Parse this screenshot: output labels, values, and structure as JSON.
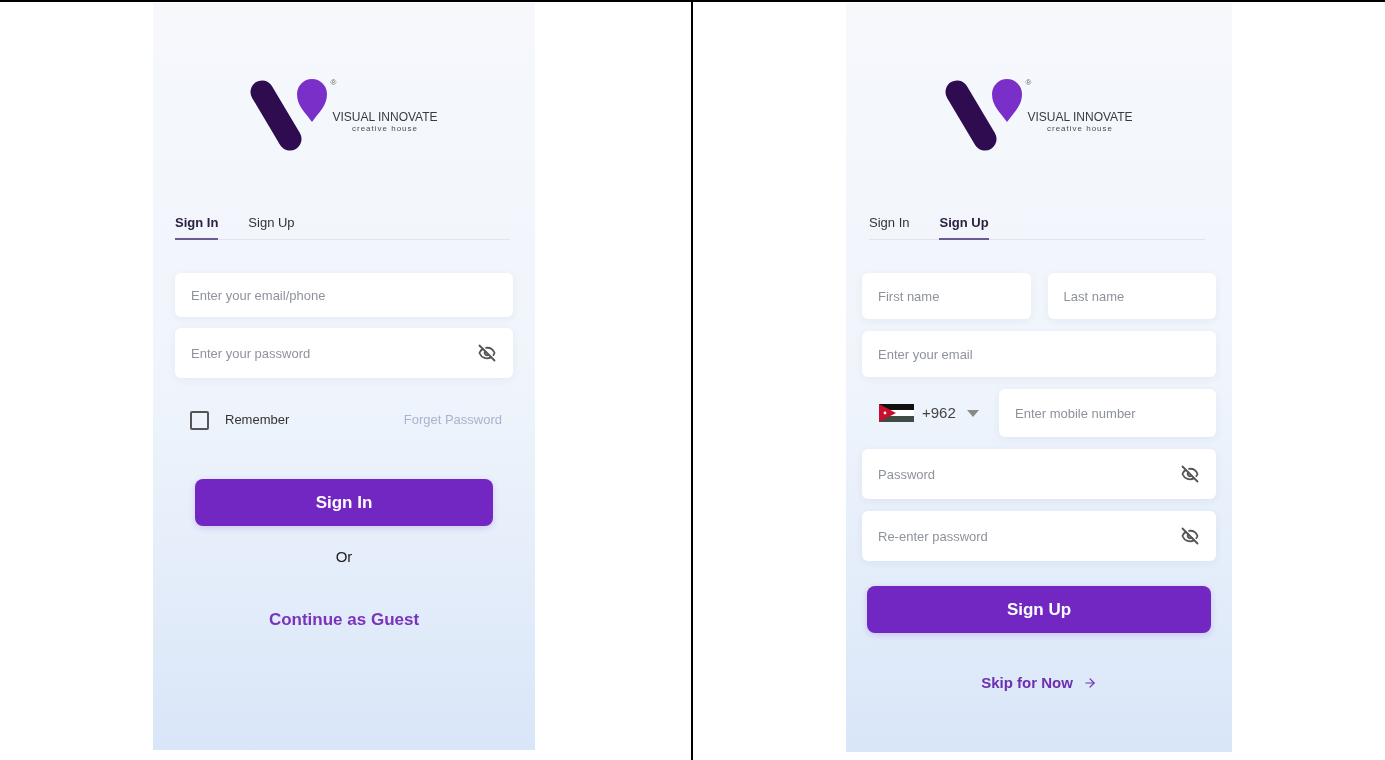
{
  "screens": [
    {
      "kind": "sign_in",
      "logo": {
        "registered_mark": "®",
        "name": "VISUAL INNOVATE",
        "tagline": "creative house"
      },
      "tabs": [
        {
          "label": "Sign In",
          "selected": true
        },
        {
          "label": "Sign Up",
          "selected": false
        }
      ],
      "fields": [
        {
          "kind": "text",
          "placeholder": "Enter your email/phone"
        },
        {
          "kind": "password",
          "placeholder": "Enter your password"
        }
      ],
      "options": {
        "remember": {
          "label": "Remember",
          "checked": false
        },
        "forgot_link": "Forget Password"
      },
      "primary_button": "Sign In",
      "separator": "Or",
      "footer_link": {
        "label": "Continue as Guest"
      }
    },
    {
      "kind": "sign_up",
      "logo": {
        "registered_mark": "®",
        "name": "VISUAL INNOVATE",
        "tagline": "creative house"
      },
      "tabs": [
        {
          "label": "Sign In",
          "selected": false
        },
        {
          "label": "Sign Up",
          "selected": true
        }
      ],
      "fields": [
        {
          "kind": "pair",
          "fields": [
            {
              "placeholder": "First name"
            },
            {
              "placeholder": "Last name"
            }
          ]
        },
        {
          "kind": "text",
          "placeholder": "Enter your email"
        },
        {
          "kind": "phone",
          "country_code": "+962",
          "placeholder": "Enter mobile number"
        },
        {
          "kind": "password",
          "placeholder": "Password"
        },
        {
          "kind": "password",
          "placeholder": "Re-enter password"
        }
      ],
      "primary_button": "Sign Up",
      "footer_link": {
        "label": "Skip for Now",
        "arrow": true
      }
    }
  ]
}
